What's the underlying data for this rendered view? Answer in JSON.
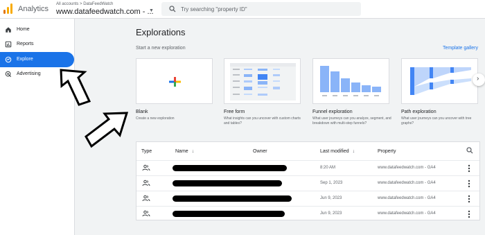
{
  "header": {
    "app_name": "Analytics",
    "account_path": "All accounts > DataFeedWatch",
    "account_name": "www.datafeedwatch.com - ...",
    "search_placeholder": "Try searching \"property ID\""
  },
  "sidebar": {
    "items": [
      {
        "label": "Home",
        "icon": "home-icon"
      },
      {
        "label": "Reports",
        "icon": "reports-icon"
      },
      {
        "label": "Explore",
        "icon": "explore-icon",
        "active": true
      },
      {
        "label": "Advertising",
        "icon": "advertising-icon"
      }
    ]
  },
  "main": {
    "title": "Explorations",
    "section_label": "Start a new exploration",
    "gallery_link": "Template gallery",
    "templates": [
      {
        "title": "Blank",
        "desc": "Create a new exploration"
      },
      {
        "title": "Free form",
        "desc": "What insights can you uncover with custom charts and tables?"
      },
      {
        "title": "Funnel exploration",
        "desc": "What user journeys can you analyze, segment, and breakdown with multi-step funnels?"
      },
      {
        "title": "Path exploration",
        "desc": "What user journeys can you uncover with tree graphs?"
      }
    ]
  },
  "table": {
    "columns": {
      "type": "Type",
      "name": "Name",
      "owner": "Owner",
      "last_modified": "Last modified",
      "property": "Property"
    },
    "rows": [
      {
        "last_modified": "8:20 AM",
        "property": "www.datafeedwatch.com - GA4"
      },
      {
        "last_modified": "Sep 1, 2023",
        "property": "www.datafeedwatch.com - GA4"
      },
      {
        "last_modified": "Jun 9, 2023",
        "property": "www.datafeedwatch.com - GA4"
      },
      {
        "last_modified": "Jun 9, 2023",
        "property": "www.datafeedwatch.com - GA4"
      }
    ]
  },
  "colors": {
    "accent": "#1a73e8",
    "analytics_orange": "#f9ab00",
    "analytics_dark_orange": "#e37400",
    "main_background": "#f1f3f4",
    "funnel_bar": "#8ab4f8"
  }
}
